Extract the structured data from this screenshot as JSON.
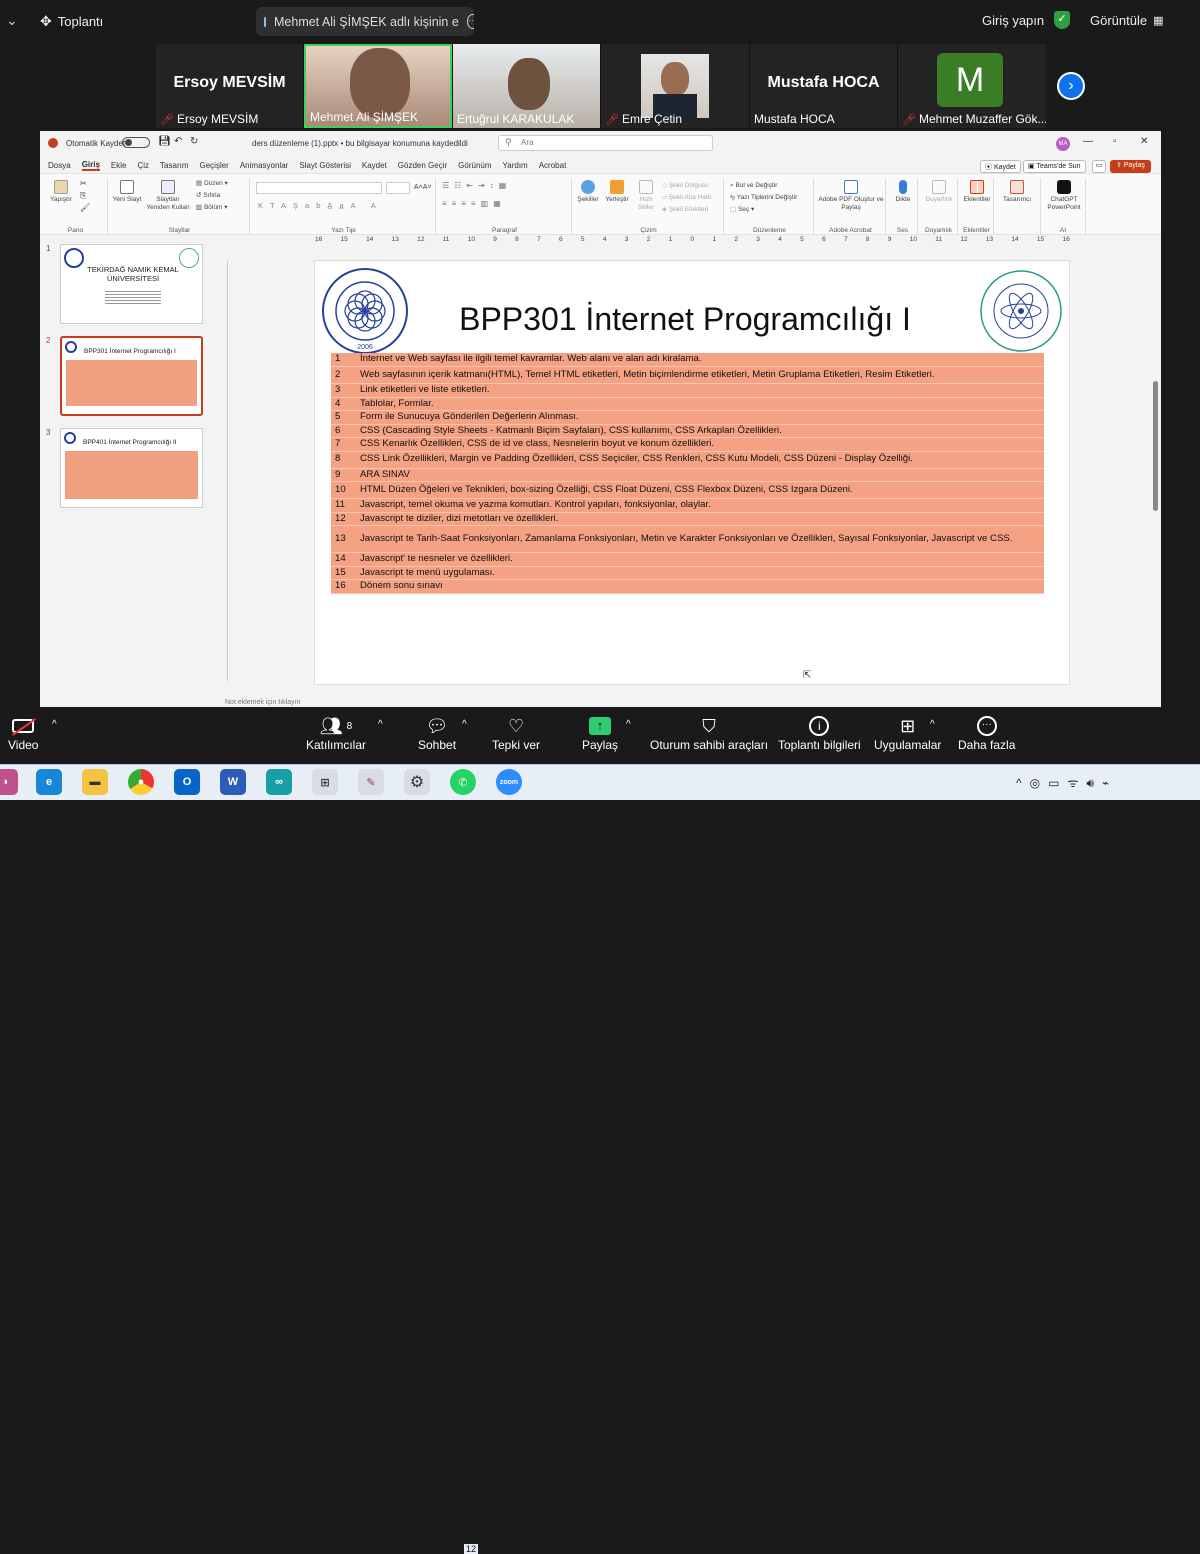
{
  "topbar": {
    "meeting_label": "Toplantı",
    "sharing_text": "Mehmet Ali ŞİMŞEK adlı kişinin e",
    "signin_label": "Giriş yapın",
    "view_label": "Görüntüle"
  },
  "participants": [
    {
      "big": "Ersoy MEVSİM",
      "label": "Ersoy MEVSİM"
    },
    {
      "big": "",
      "label": "Mehmet Ali ŞİMŞEK"
    },
    {
      "big": "",
      "label": "Ertuğrul KARAKULAK"
    },
    {
      "big": "",
      "label": "Emre Çetin"
    },
    {
      "big": "Mustafa HOCA",
      "label": "Mustafa HOCA"
    },
    {
      "big": "M",
      "label": "Mehmet Muzaffer Gök..."
    }
  ],
  "ppt": {
    "autosave_label": "Otomatik Kaydet",
    "file_title": "ders düzenleme (1).pptx • bu bilgisayar konumuna kaydedildi",
    "search_placeholder": "Ara",
    "user_initials": "MA",
    "menu": [
      "Dosya",
      "Giriş",
      "Ekle",
      "Çiz",
      "Tasarım",
      "Geçişler",
      "Animasyonlar",
      "Slayt Gösterisi",
      "Kaydet",
      "Gözden Geçir",
      "Görünüm",
      "Yardım",
      "Acrobat"
    ],
    "kaydet_btn": "Kaydet",
    "teams_btn": "Teams'de Sun",
    "share_btn": "Paylaş",
    "ribbon": {
      "paste": "Yapıştır",
      "pano": "Pano",
      "new_slide": "Yeni Slayt",
      "reuse": "Slaytları Yeniden Kullan",
      "duzen": "Düzen",
      "sifirla": "Sıfırla",
      "bolum": "Bölüm",
      "slaytlar": "Slaytlar",
      "yazi_tipi": "Yazı Tipi",
      "paragraf": "Paragraf",
      "sekiller": "Şekiller",
      "yerlestir": "Yerleştir",
      "hizli": "Hızlı Stiller",
      "dolgu": "Şekil Dolgusu",
      "ana_hat": "Şekil Ana Hattı",
      "efekt": "Şekil Efektleri",
      "cizim": "Çizim",
      "bul": "Bul ve Değiştir",
      "yazi_tipleri": "Yazı Tiplerini Değiştir",
      "sec": "Seç",
      "duzenleme": "Düzenleme",
      "adobe": "Adobe PDF Oluştur ve Paylaş",
      "adobe_grp": "Adobe Acrobat",
      "dikte": "Dikte",
      "ses": "Ses",
      "duyarlilik": "Duyarlılık",
      "eklentiler": "Eklentiler",
      "tasarimci": "Tasarımcı",
      "chatgpt": "ChatGPT PowerPoint",
      "ai": "AI"
    },
    "ruler": [
      "16",
      "15",
      "14",
      "13",
      "12",
      "11",
      "10",
      "9",
      "8",
      "7",
      "6",
      "5",
      "4",
      "3",
      "2",
      "1",
      "0",
      "1",
      "2",
      "3",
      "4",
      "5",
      "6",
      "7",
      "8",
      "9",
      "10",
      "11",
      "12",
      "13",
      "14",
      "15",
      "16"
    ],
    "thumbs": [
      {
        "num": "1",
        "title": "TEKİRDAĞ NAMIK KEMAL ÜNİVERSİTESİ"
      },
      {
        "num": "2",
        "title": "BPP301 İnternet Programcılığı I"
      },
      {
        "num": "3",
        "title": "BPP401 İnternet Programcılığı II"
      }
    ],
    "notes_placeholder": "Not eklemek için tıklayın"
  },
  "slide": {
    "title": "BPP301 İnternet Programcılığı I",
    "logo_text": "2006",
    "rows": [
      {
        "n": "1",
        "t": "İnternet ve Web sayfası ile ilgili temel kavramlar. Web alanı ve alan adı kiralama."
      },
      {
        "n": "2",
        "t": "Web sayfasının içerik katmanı(HTML), Temel HTML etiketleri, Metin biçimlendirme etiketleri, Metin Gruplama Etiketleri, Resim Etiketleri."
      },
      {
        "n": "3",
        "t": "Link etiketleri ve liste etiketleri."
      },
      {
        "n": "4",
        "t": "Tablolar, Formlar."
      },
      {
        "n": "5",
        "t": "Form ile Sunucuya Gönderilen Değerlerin Alınması."
      },
      {
        "n": "6",
        "t": "CSS (Cascading Style Sheets - Katmanlı Biçim Sayfaları), CSS kullanımı, CSS Arkaplan Özellikleri."
      },
      {
        "n": "7",
        "t": "CSS Kenarlık Özellikleri, CSS de id ve class, Nesnelerin boyut ve konum özellikleri."
      },
      {
        "n": "8",
        "t": "CSS Link Özellikleri, Margin ve Padding Özellikleri, CSS Seçiciler, CSS Renkleri, CSS Kutu Modeli, CSS Düzeni - Display Özelliği."
      },
      {
        "n": "9",
        "t": "ARA SINAV"
      },
      {
        "n": "10",
        "t": "HTML Düzen Öğeleri ve Teknikleri, box-sizing Özelliği, CSS Float Düzeni, CSS Flexbox Düzeni, CSS Izgara Düzeni."
      },
      {
        "n": "11",
        "t": "Javascript, temel okuma ve yazma komutları. Kontrol yapıları, fonksiyonlar, olaylar."
      },
      {
        "n": "12",
        "t": "Javascript te diziler, dizi metotları ve özellikleri."
      },
      {
        "n": "13",
        "t": "Javascript te Tarih-Saat Fonksiyonları, Zamanlama Fonksiyonları, Metin ve Karakter Fonksiyonları ve Özellikleri, Sayısal Fonksiyonlar, Javascript ve CSS."
      },
      {
        "n": "14",
        "t": "Javascript' te nesneler ve özellikleri."
      },
      {
        "n": "15",
        "t": "Javascript te menü uygulaması."
      },
      {
        "n": "16",
        "t": "Dönem sonu sınavı"
      }
    ]
  },
  "toolbar": {
    "video": "Video",
    "participants": "Katılımcılar",
    "participant_count": "8",
    "chat": "Sohbet",
    "react": "Tepki ver",
    "share": "Paylaş",
    "host_tools": "Oturum sahibi araçları",
    "meeting_info": "Toplantı bilgileri",
    "apps": "Uygulamalar",
    "more": "Daha fazla"
  },
  "taskbar": {
    "whatsapp_badge": "12"
  },
  "colors": {
    "accent_ppt": "#c43e1c",
    "table_fill": "#f4a184",
    "zoom_bg": "#1a1a1a",
    "active_speaker": "#3ecf5c"
  }
}
